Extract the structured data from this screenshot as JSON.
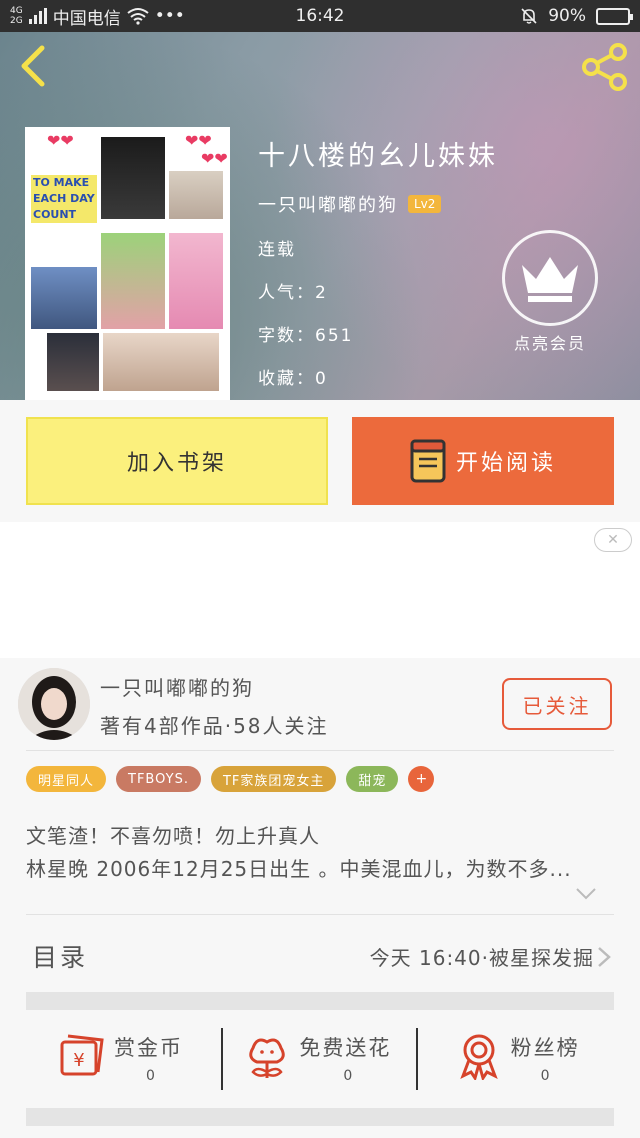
{
  "status_bar": {
    "network_top": "4G",
    "network_bottom": "2G",
    "carrier": "中国电信",
    "dots": "•••",
    "time": "16:42",
    "battery": "90%",
    "battery_level": 0.9
  },
  "book": {
    "title": "十八楼的幺儿妹妹",
    "author": "一只叫嘟嘟的狗",
    "author_level": "Lv2",
    "status": "连载",
    "popularity": "人气：2",
    "word_count": "字数：651",
    "favorites": "收藏：0",
    "cover_caption": "TO MAKE EACH DAY COUNT"
  },
  "vip": {
    "label": "点亮会员"
  },
  "actions": {
    "add_shelf": "加入书架",
    "start_reading": "开始阅读"
  },
  "ad": {
    "close_symbol": "✕"
  },
  "author_card": {
    "name": "一只叫嘟嘟的狗",
    "stats": "著有4部作品·58人关注",
    "follow_label": "已关注"
  },
  "tags": [
    {
      "label": "明星同人",
      "color": "#f3b63c"
    },
    {
      "label": "TFBOYS.",
      "color": "#c97a63"
    },
    {
      "label": "TF家族团宠女主",
      "color": "#d8a33a"
    },
    {
      "label": "甜宠",
      "color": "#8cb75a"
    }
  ],
  "tag_add": "+",
  "description": {
    "line1": "文笔渣！不喜勿喷！勿上升真人",
    "line2": "林星晚 2006年12月25日出生 。中美混血儿，为数不多..."
  },
  "toc": {
    "label": "目录",
    "update": "今天 16:40·被星探发掘"
  },
  "bottom_bar": [
    {
      "label": "赏金币",
      "count": "0",
      "icon": "reward-envelope-icon"
    },
    {
      "label": "免费送花",
      "count": "0",
      "icon": "flower-icon"
    },
    {
      "label": "粉丝榜",
      "count": "0",
      "icon": "medal-icon"
    }
  ],
  "colors": {
    "accent_orange": "#ec6a3c",
    "shelf_yellow": "#fbf07d",
    "follow_red": "#e65a3a"
  }
}
